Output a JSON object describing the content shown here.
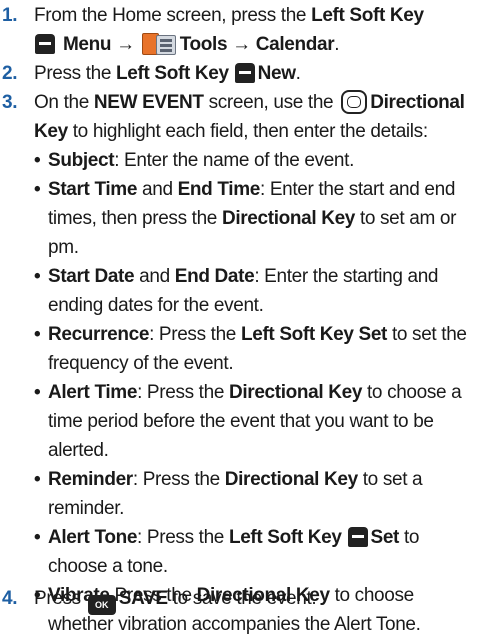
{
  "steps": [
    {
      "num": "1.",
      "pre": "From the Home screen, press the ",
      "b1": "Left Soft Key",
      "menu": "Menu",
      "arrow": "→",
      "tools": "Tools",
      "calendar": "Calendar",
      "end": "."
    },
    {
      "num": "2.",
      "pre": "Press the ",
      "b1": "Left Soft Key",
      "b2": "New",
      "end": "."
    },
    {
      "num": "3.",
      "pre": "On the ",
      "b1": "NEW EVENT",
      "mid": " screen, use the ",
      "b2": "Directional Key",
      "post": " to highlight each field, then enter the details:",
      "bullets": [
        {
          "title": "Subject",
          "text": ": Enter the name of the event."
        },
        {
          "title": "Start Time",
          "and": " and ",
          "title2": "End Time",
          "text": ": Enter the start and end times, then press the ",
          "bold3": "Directional Key",
          "text2": " to set am or pm."
        },
        {
          "title": "Start Date",
          "and": " and ",
          "title2": "End Date",
          "text": ": Enter the starting and ending dates for the event."
        },
        {
          "title": "Recurrence",
          "text": ": Press the ",
          "bold3": "Left Soft Key Set",
          "text2": " to set the frequency of the event."
        },
        {
          "title": "Alert Time",
          "text": ": Press the ",
          "bold3": "Directional Key",
          "text2": " to choose a time period before the event that you want to be alerted."
        },
        {
          "title": "Reminder",
          "text": ": Press the ",
          "bold3": "Directional Key",
          "text2": " to set a reminder."
        },
        {
          "title": "Alert Tone",
          "text": ": Press the ",
          "bold3": "Left Soft Key",
          "bold4": "Set",
          "text2": " to choose a tone."
        },
        {
          "title": "Vibrate",
          "text": " Press the ",
          "bold3": "Directional Key",
          "text2": " to choose whether vibration accompanies the Alert Tone."
        }
      ]
    },
    {
      "num": "4.",
      "pre": "Press ",
      "ok": "OK",
      "b1": "SAVE",
      "post": " to save the event."
    }
  ],
  "bullet_char": "•",
  "colors": {
    "number": "#1e5fa3",
    "text": "#1a1a1a"
  }
}
